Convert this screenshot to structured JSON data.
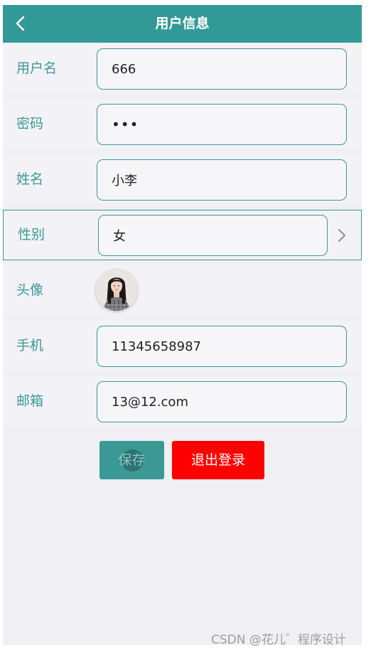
{
  "header": {
    "title": "用户信息",
    "back_icon": "chevron-left-icon"
  },
  "form": {
    "username": {
      "label": "用户名",
      "value": "666"
    },
    "password": {
      "label": "密码",
      "value": "•••"
    },
    "name": {
      "label": "姓名",
      "value": "小李"
    },
    "gender": {
      "label": "性别",
      "value": "女",
      "chevron_icon": "chevron-right-icon"
    },
    "avatar": {
      "label": "头像",
      "image": "avatar-photo"
    },
    "phone": {
      "label": "手机",
      "value": "11345658987"
    },
    "email": {
      "label": "邮箱",
      "value": "13@12.com"
    }
  },
  "actions": {
    "save_label": "保存",
    "logout_label": "退出登录"
  },
  "watermark": "CSDN @花儿゛程序设计",
  "colors": {
    "primary": "#329a96",
    "danger": "#ff0000",
    "background": "#f0eff3"
  }
}
